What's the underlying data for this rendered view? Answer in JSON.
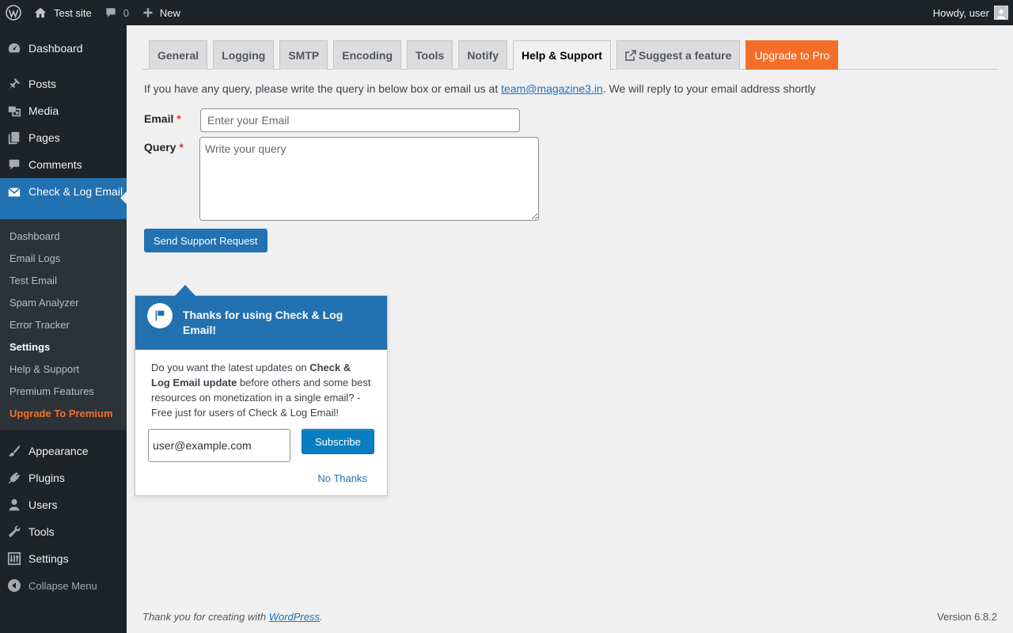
{
  "adminbar": {
    "site_name": "Test site",
    "comments_count": "0",
    "new_label": "New",
    "howdy": "Howdy, user"
  },
  "sidebar": {
    "items_top": [
      {
        "label": "Dashboard",
        "icon": "dashboard-icon"
      }
    ],
    "items_mid": [
      {
        "label": "Posts",
        "icon": "pin-icon"
      },
      {
        "label": "Media",
        "icon": "media-icon"
      },
      {
        "label": "Pages",
        "icon": "pages-icon"
      },
      {
        "label": "Comments",
        "icon": "comment-icon"
      }
    ],
    "current": {
      "label": "Check & Log Email",
      "icon": "envelope-icon"
    },
    "submenu": [
      {
        "label": "Dashboard"
      },
      {
        "label": "Email Logs"
      },
      {
        "label": "Test Email"
      },
      {
        "label": "Spam Analyzer"
      },
      {
        "label": "Error Tracker"
      },
      {
        "label": "Settings"
      },
      {
        "label": "Help & Support"
      },
      {
        "label": "Premium Features"
      },
      {
        "label": "Upgrade To Premium"
      }
    ],
    "items_bottom": [
      {
        "label": "Appearance",
        "icon": "brush-icon"
      },
      {
        "label": "Plugins",
        "icon": "plug-icon"
      },
      {
        "label": "Users",
        "icon": "user-icon"
      },
      {
        "label": "Tools",
        "icon": "wrench-icon"
      },
      {
        "label": "Settings",
        "icon": "sliders-icon"
      }
    ],
    "collapse": "Collapse Menu"
  },
  "tabs": [
    {
      "label": "General"
    },
    {
      "label": "Logging"
    },
    {
      "label": "SMTP"
    },
    {
      "label": "Encoding"
    },
    {
      "label": "Tools"
    },
    {
      "label": "Notify"
    },
    {
      "label": "Help & Support",
      "active": true
    },
    {
      "label": "Suggest a feature"
    },
    {
      "label": "Upgrade to Pro"
    }
  ],
  "support": {
    "intro_before": "If you have any query, please write the query in below box or email us at ",
    "email_link": "team@magazine3.in",
    "intro_after": ". We will reply to your email address shortly",
    "email_label": "Email",
    "email_placeholder": "Enter your Email",
    "query_label": "Query",
    "query_placeholder": "Write your query",
    "required_mark": "*",
    "submit_label": "Send Support Request"
  },
  "pointer": {
    "title": "Thanks for using Check & Log Email!",
    "body_1": "Do you want the latest updates on ",
    "body_bold": "Check & Log Email update",
    "body_2": " before others and some best resources on monetization in a single email? - Free just for users of Check & Log Email!",
    "input_value": "user@example.com",
    "subscribe_label": "Subscribe",
    "no_thanks": "No Thanks"
  },
  "footer": {
    "thanks_before": "Thank you for creating with ",
    "wp_link": "WordPress",
    "thanks_after": ".",
    "version": "Version 6.8.2"
  },
  "colors": {
    "admin_dark": "#1d2327",
    "accent_blue": "#2271b1",
    "pro_orange": "#f56e28"
  }
}
